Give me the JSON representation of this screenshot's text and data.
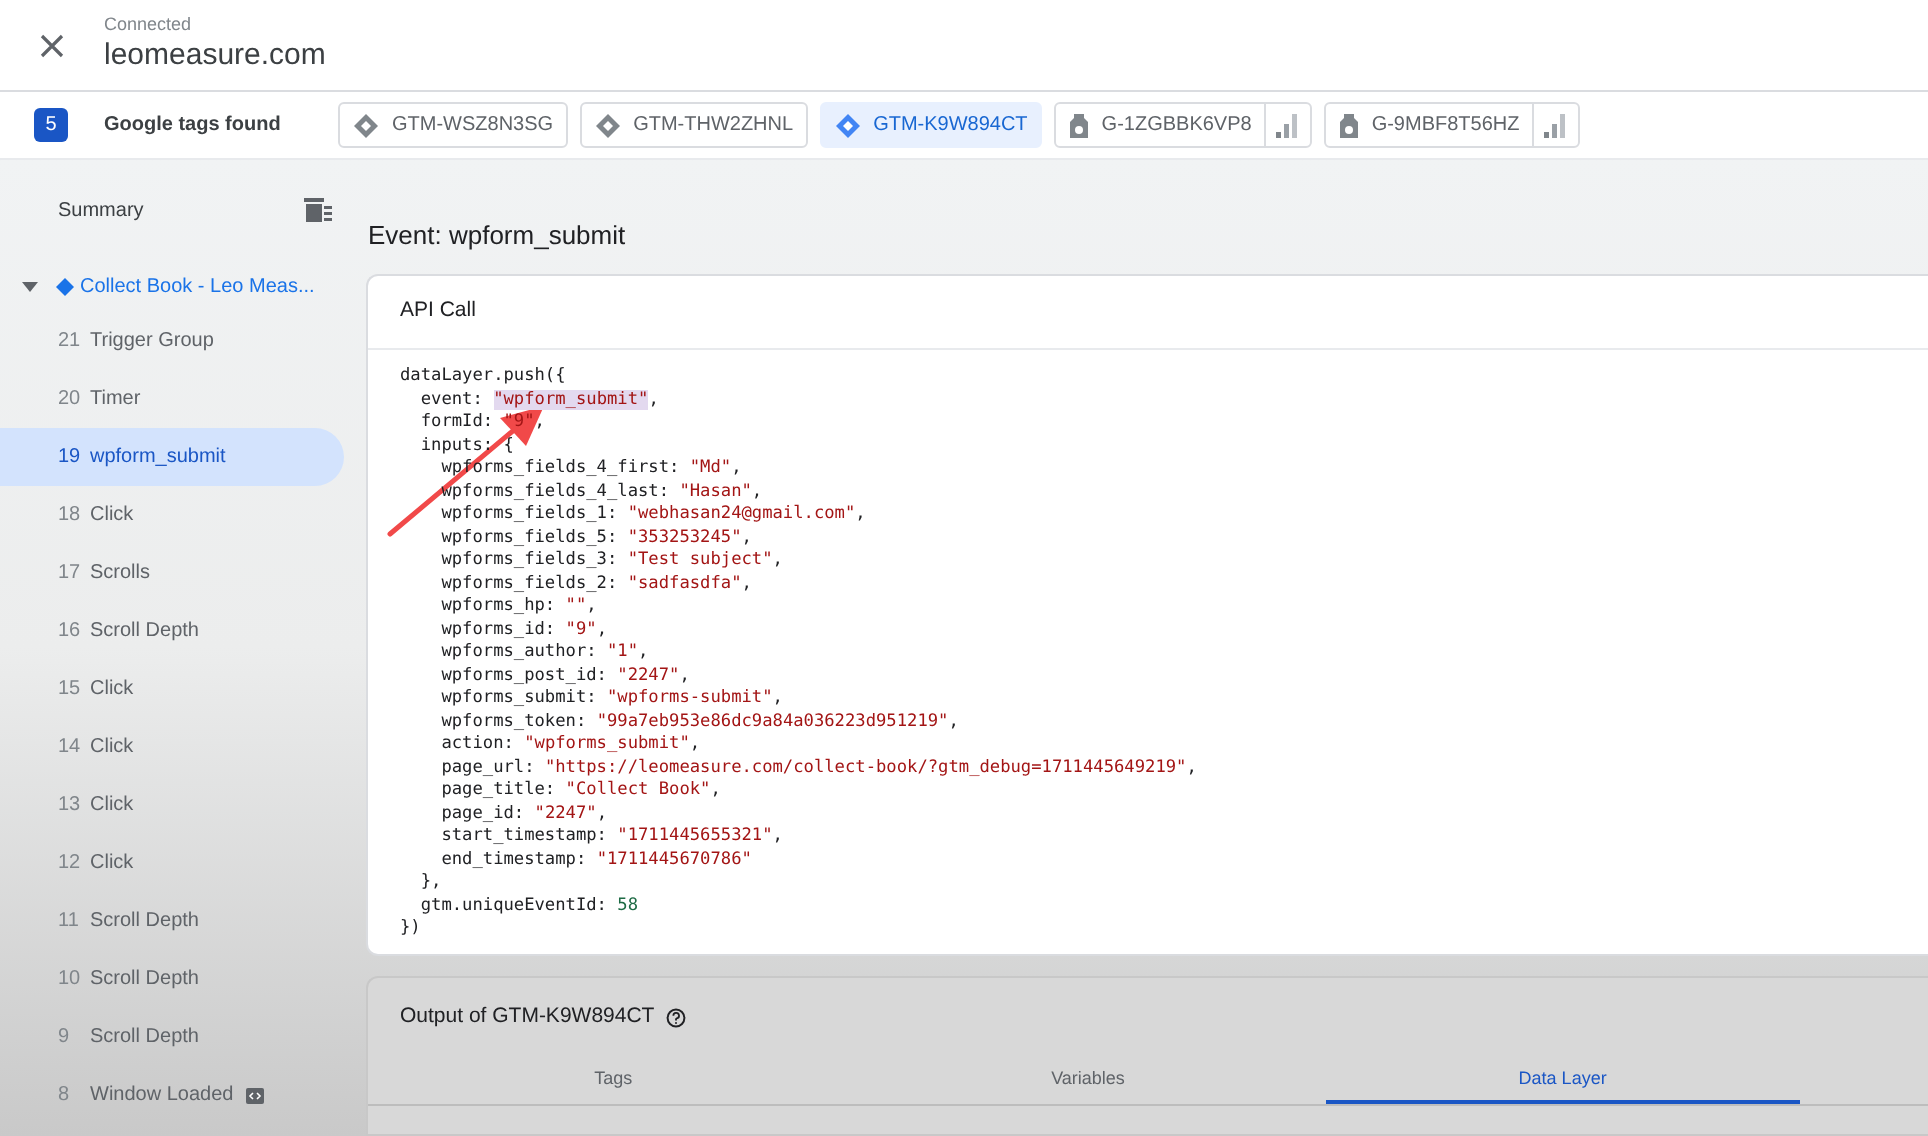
{
  "header": {
    "status": "Connected",
    "domain": "leomeasure.com"
  },
  "tag_bar": {
    "count": "5",
    "label": "Google tags found",
    "tags": [
      {
        "label": "GTM-WSZ8N3SG",
        "kind": "gtm",
        "selected": false
      },
      {
        "label": "GTM-THW2ZHNL",
        "kind": "gtm",
        "selected": false
      },
      {
        "label": "GTM-K9W894CT",
        "kind": "gtm",
        "selected": true
      },
      {
        "label": "G-1ZGBBK6VP8",
        "kind": "ga",
        "selected": false
      },
      {
        "label": "G-9MBF8T56HZ",
        "kind": "ga",
        "selected": false
      }
    ]
  },
  "sidebar": {
    "summary": "Summary",
    "page": {
      "label": "Collect Book - Leo Meas...",
      "expanded": true,
      "children": [
        {
          "number": "21",
          "label": "Trigger Group",
          "selected": false
        },
        {
          "number": "20",
          "label": "Timer",
          "selected": false
        },
        {
          "number": "19",
          "label": "wpform_submit",
          "selected": true
        },
        {
          "number": "18",
          "label": "Click",
          "selected": false
        },
        {
          "number": "17",
          "label": "Scrolls",
          "selected": false
        },
        {
          "number": "16",
          "label": "Scroll Depth",
          "selected": false
        },
        {
          "number": "15",
          "label": "Click",
          "selected": false
        },
        {
          "number": "14",
          "label": "Click",
          "selected": false
        },
        {
          "number": "13",
          "label": "Click",
          "selected": false
        },
        {
          "number": "12",
          "label": "Click",
          "selected": false
        },
        {
          "number": "11",
          "label": "Scroll Depth",
          "selected": false
        },
        {
          "number": "10",
          "label": "Scroll Depth",
          "selected": false
        },
        {
          "number": "9",
          "label": "Scroll Depth",
          "selected": false
        },
        {
          "number": "8",
          "label": "Window Loaded",
          "selected": false,
          "code_badge": true
        }
      ]
    }
  },
  "event_title": "Event: wpform_submit",
  "api_call": {
    "title": "API Call",
    "lines": [
      {
        "key": "dataLayer.push({"
      },
      {
        "key": "  event: ",
        "value": "\"wpform_submit\"",
        "kind": "string",
        "end": ",",
        "highlighted": true
      },
      {
        "key": "  formId: ",
        "value": "\"9\"",
        "kind": "string",
        "end": ","
      },
      {
        "key": "  inputs: {"
      },
      {
        "key": "    wpforms_fields_4_first: ",
        "value": "\"Md\"",
        "kind": "string",
        "end": ","
      },
      {
        "key": "    wpforms_fields_4_last: ",
        "value": "\"Hasan\"",
        "kind": "string",
        "end": ","
      },
      {
        "key": "    wpforms_fields_1: ",
        "value": "\"webhasan24@gmail.com\"",
        "kind": "string",
        "end": ","
      },
      {
        "key": "    wpforms_fields_5: ",
        "value": "\"353253245\"",
        "kind": "string",
        "end": ","
      },
      {
        "key": "    wpforms_fields_3: ",
        "value": "\"Test subject\"",
        "kind": "string",
        "end": ","
      },
      {
        "key": "    wpforms_fields_2: ",
        "value": "\"sadfasdfa\"",
        "kind": "string",
        "end": ","
      },
      {
        "key": "    wpforms_hp: ",
        "value": "\"\"",
        "kind": "string",
        "end": ","
      },
      {
        "key": "    wpforms_id: ",
        "value": "\"9\"",
        "kind": "string",
        "end": ","
      },
      {
        "key": "    wpforms_author: ",
        "value": "\"1\"",
        "kind": "string",
        "end": ","
      },
      {
        "key": "    wpforms_post_id: ",
        "value": "\"2247\"",
        "kind": "string",
        "end": ","
      },
      {
        "key": "    wpforms_submit: ",
        "value": "\"wpforms-submit\"",
        "kind": "string",
        "end": ","
      },
      {
        "key": "    wpforms_token: ",
        "value": "\"99a7eb953e86dc9a84a036223d951219\"",
        "kind": "string",
        "end": ","
      },
      {
        "key": "    action: ",
        "value": "\"wpforms_submit\"",
        "kind": "string",
        "end": ","
      },
      {
        "key": "    page_url: ",
        "value": "\"https://leomeasure.com/collect-book/?gtm_debug=1711445649219\"",
        "kind": "string",
        "end": ","
      },
      {
        "key": "    page_title: ",
        "value": "\"Collect Book\"",
        "kind": "string",
        "end": ","
      },
      {
        "key": "    page_id: ",
        "value": "\"2247\"",
        "kind": "string",
        "end": ","
      },
      {
        "key": "    start_timestamp: ",
        "value": "\"1711445655321\"",
        "kind": "string",
        "end": ","
      },
      {
        "key": "    end_timestamp: ",
        "value": "\"1711445670786\"",
        "kind": "string"
      },
      {
        "key": "  },"
      },
      {
        "key": "  gtm.uniqueEventId: ",
        "value": "58",
        "kind": "number"
      },
      {
        "key": "})"
      }
    ]
  },
  "output": {
    "title": "Output of GTM-K9W894CT",
    "tabs": [
      {
        "label": "Tags",
        "selected": false
      },
      {
        "label": "Variables",
        "selected": false
      },
      {
        "label": "Data Layer",
        "selected": true
      }
    ]
  }
}
